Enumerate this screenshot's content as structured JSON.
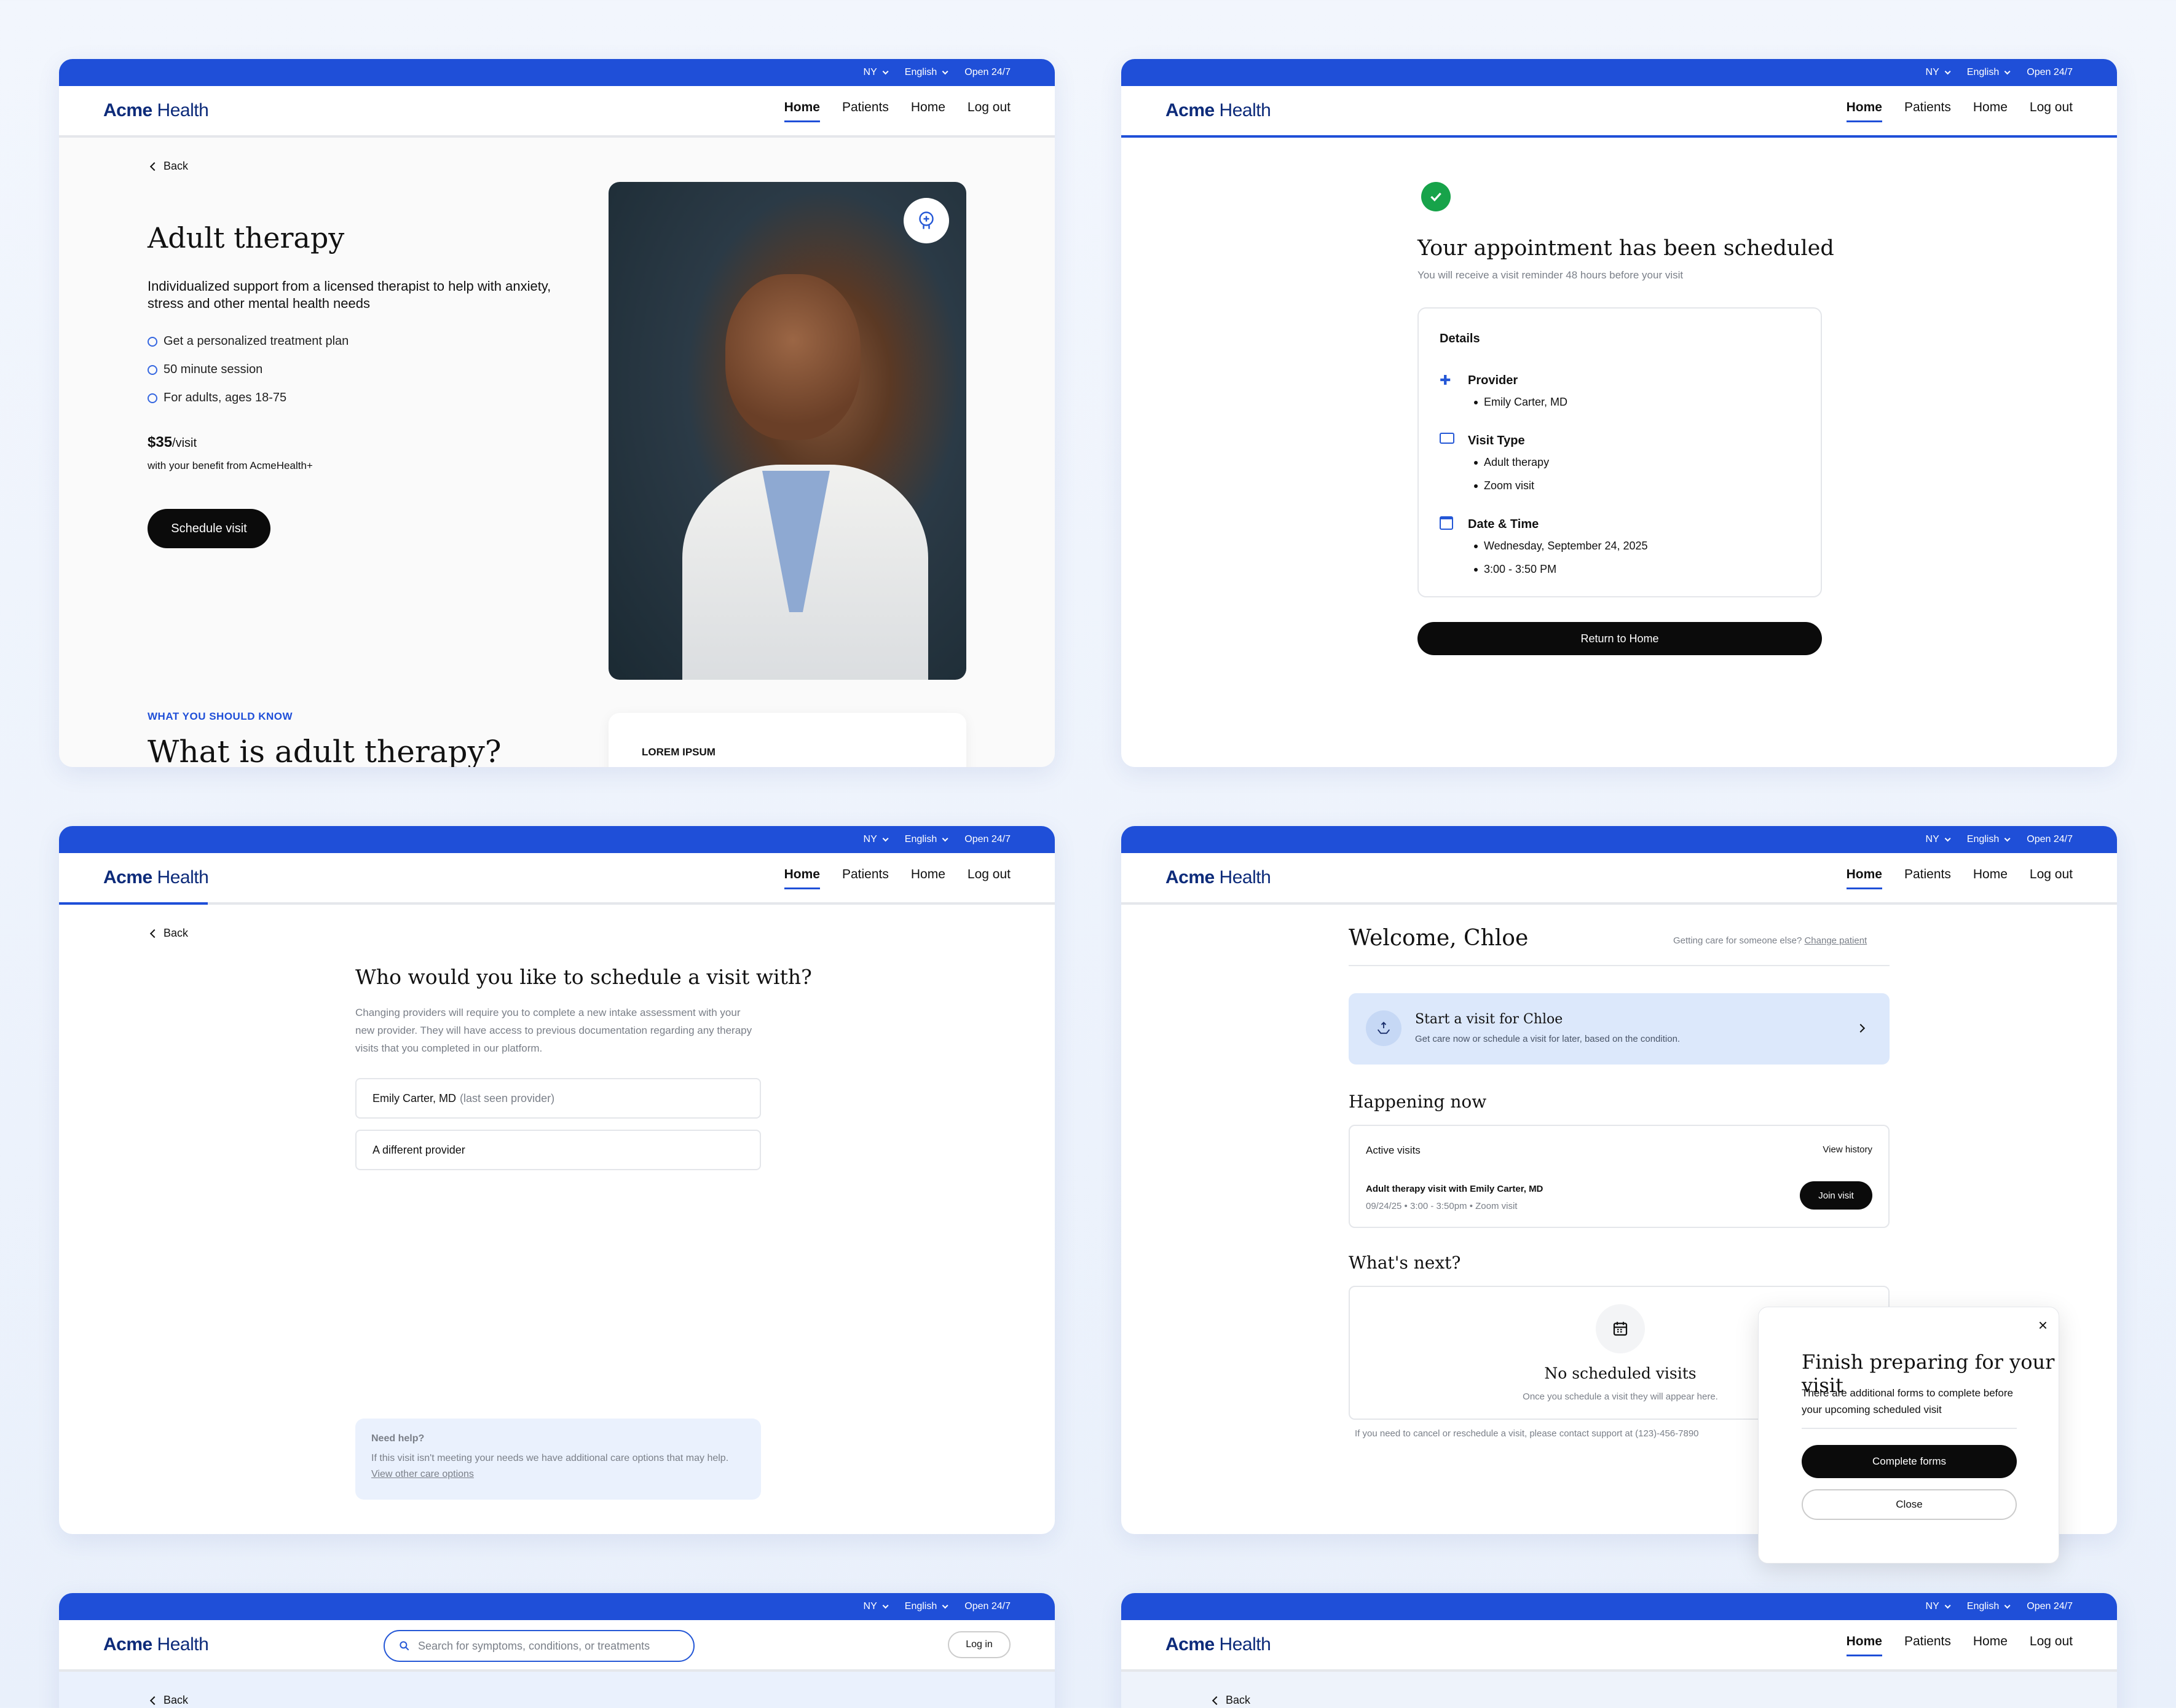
{
  "topbar": {
    "region": "NY",
    "language": "English",
    "hours": "Open 24/7"
  },
  "brand": {
    "logo_bold": "Acme",
    "logo_light": " Health",
    "primary": "#1f4fd8"
  },
  "nav": {
    "home": "Home",
    "patients": "Patients",
    "home2": "Home",
    "logout": "Log out"
  },
  "common": {
    "back": "Back"
  },
  "service": {
    "title": "Adult therapy",
    "description": "Individualized support from a licensed therapist to help with anxiety, stress and other mental health needs",
    "features": [
      "Get a personalized treatment plan",
      "50 minute session",
      "For adults, ages 18-75"
    ],
    "price": "$35",
    "price_unit": "/visit",
    "benefit": "with your benefit from AcmeHealth+",
    "cta": "Schedule visit",
    "eyebrow": "WHAT YOU SHOULD KNOW",
    "section_title": "What is adult therapy?",
    "card_label": "LOREM IPSUM",
    "badge_icon": "brain-icon"
  },
  "confirm": {
    "title": "Your appointment has been scheduled",
    "subtitle": "You will receive a visit reminder 48 hours before your visit",
    "details_label": "Details",
    "provider_label": "Provider",
    "provider": "Emily Carter, MD",
    "visit_type_label": "Visit Type",
    "visit_types": [
      "Adult therapy",
      "Zoom visit"
    ],
    "datetime_label": "Date & Time",
    "date": "Wednesday, September 24, 2025",
    "time": "3:00 - 3:50 PM",
    "cta": "Return to Home"
  },
  "provider_select": {
    "title": "Who would you like to schedule a visit with?",
    "description": "Changing providers will require you to complete a new intake assessment with your new provider. They will have access to previous documentation regarding any therapy visits that you completed in our platform.",
    "option1_name": "Emily Carter, MD",
    "option1_note": "(last seen provider)",
    "option2": "A different provider",
    "help_title": "Need help?",
    "help_text": "If this visit isn't meeting your needs we have additional care options that may help.",
    "help_link": "View other care options"
  },
  "dashboard": {
    "welcome": "Welcome, Chloe",
    "care_other": "Getting care for someone else?",
    "change_patient": "Change patient",
    "start_title": "Start a visit for Chloe",
    "start_sub": "Get care now or schedule a visit for later, based on the condition.",
    "happening": "Happening now",
    "active_visits": "Active visits",
    "view_history": "View history",
    "visit_title": "Adult therapy visit with Emily Carter, MD",
    "visit_meta": "09/24/25 • 3:00 - 3:50pm • Zoom visit",
    "join": "Join visit",
    "whats_next": "What's next?",
    "no_visits": "No scheduled visits",
    "no_visits_sub": "Once you schedule a visit they will appear here.",
    "support": "If you need to cancel or reschedule a visit, please contact support at (123)-456-7890"
  },
  "modal": {
    "title": "Finish preparing for your visit",
    "text": "There are additional forms to complete before your upcoming scheduled visit",
    "primary": "Complete forms",
    "secondary": "Close"
  },
  "search": {
    "placeholder": "Search for symptoms, conditions, or treatments",
    "login": "Log in"
  }
}
